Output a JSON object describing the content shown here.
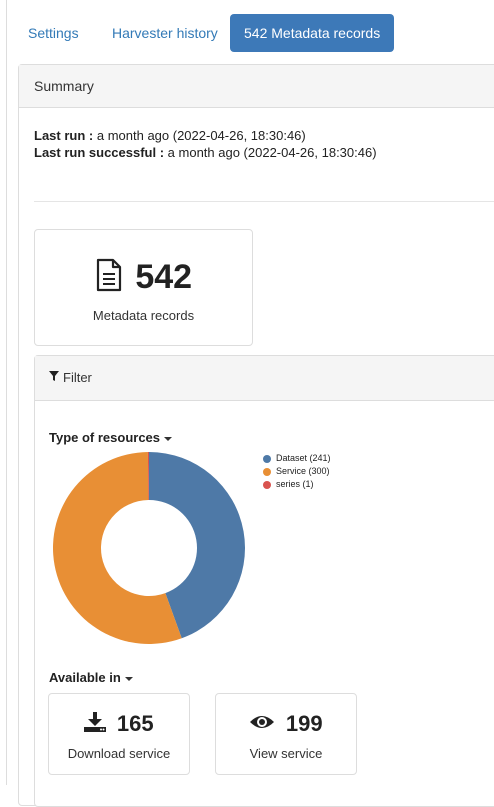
{
  "tabs": {
    "settings": "Settings",
    "history": "Harvester history",
    "records": "542 Metadata records"
  },
  "summary": {
    "title": "Summary",
    "last_run_label": "Last run :",
    "last_run_value": "a month ago (2022-04-26, 18:30:46)",
    "last_success_label": "Last run successful :",
    "last_success_value": "a month ago (2022-04-26, 18:30:46)"
  },
  "stat": {
    "count": "542",
    "label": "Metadata records",
    "icon": "document-icon"
  },
  "filter": {
    "title": "Filter",
    "type_title": "Type of resources",
    "available_title": "Available in"
  },
  "colors": {
    "accent": "#3d79b8",
    "link": "#337ab7",
    "dataset": "#4e79a7",
    "service": "#e88f35",
    "series": "#d9534f"
  },
  "chart_data": {
    "type": "pie",
    "donut": true,
    "title": "Type of resources",
    "legend_position": "right",
    "slices": [
      {
        "label": "Dataset (241)",
        "value": 241,
        "color": "#4e79a7"
      },
      {
        "label": "Service (300)",
        "value": 300,
        "color": "#e88f35"
      },
      {
        "label": "series (1)",
        "value": 1,
        "color": "#d9534f"
      }
    ]
  },
  "services": {
    "download": {
      "count": "165",
      "label": "Download service",
      "icon": "download-icon"
    },
    "view": {
      "count": "199",
      "label": "View service",
      "icon": "eye-icon"
    }
  }
}
